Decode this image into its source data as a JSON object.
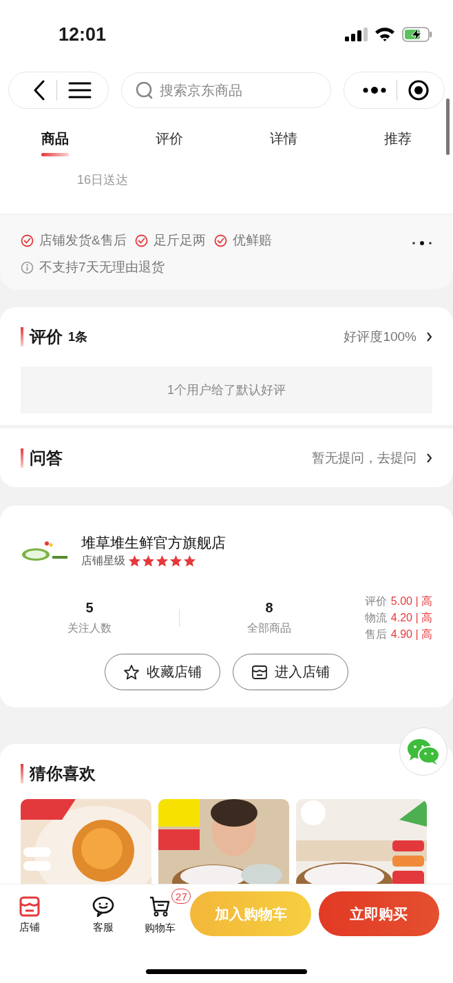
{
  "status_bar": {
    "time": "12:01"
  },
  "nav": {
    "search_placeholder": "搜索京东商品"
  },
  "tabs": [
    {
      "label": "商品",
      "selected": true
    },
    {
      "label": "评价",
      "selected": false
    },
    {
      "label": "详情",
      "selected": false
    },
    {
      "label": "推荐",
      "selected": false
    }
  ],
  "delivery": {
    "text": "16日送达"
  },
  "services": {
    "guarantees": [
      {
        "label": "店铺发货&售后"
      },
      {
        "label": "足斤足两"
      },
      {
        "label": "优鲜赔"
      }
    ],
    "notice": "不支持7天无理由退货"
  },
  "reviews": {
    "title": "评价",
    "count": "1条",
    "rating": "好评度100%",
    "message": "1个用户给了默认好评"
  },
  "qa": {
    "title": "问答",
    "link": "暂无提问，去提问"
  },
  "store": {
    "name": "堆草堆生鲜官方旗舰店",
    "rank_label": "店铺星级",
    "stars": 5,
    "stats": [
      {
        "value": "5",
        "label": "关注人数"
      },
      {
        "value": "8",
        "label": "全部商品"
      }
    ],
    "scores": [
      {
        "label": "评价",
        "value": "5.00 | 高"
      },
      {
        "label": "物流",
        "value": "4.20 | 高"
      },
      {
        "label": "售后",
        "value": "4.90 | 高"
      }
    ],
    "buttons": [
      {
        "kind": "favorite",
        "label": "收藏店铺"
      },
      {
        "kind": "enter",
        "label": "进入店铺"
      }
    ]
  },
  "recommend": {
    "title": "猜你喜欢"
  },
  "bottom_bar": {
    "actions": [
      {
        "kind": "store",
        "label": "店铺"
      },
      {
        "kind": "service",
        "label": "客服"
      },
      {
        "kind": "cart",
        "label": "购物车",
        "badge": "27"
      }
    ],
    "add_to_cart": "加入购物车",
    "buy_now": "立即购买"
  }
}
